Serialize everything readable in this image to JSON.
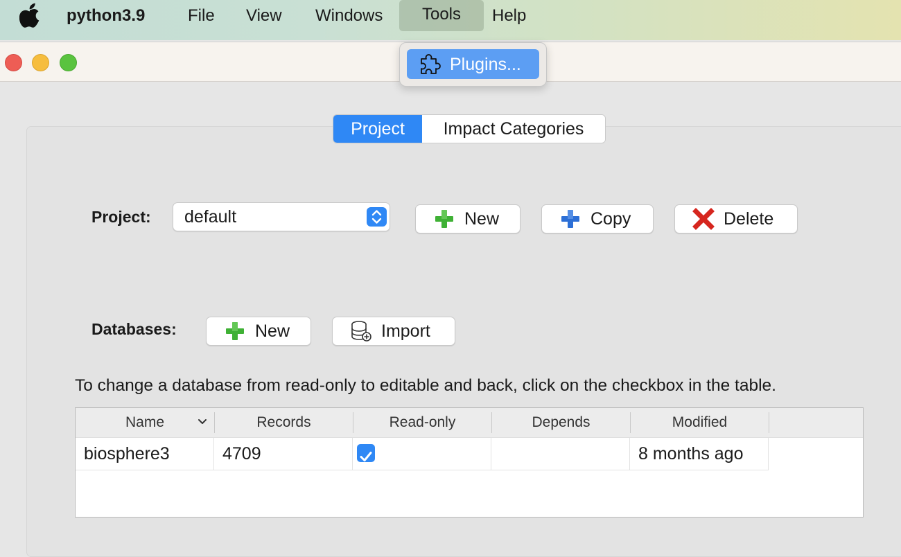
{
  "menubar": {
    "app_name": "python3.9",
    "items": [
      "File",
      "View",
      "Windows",
      "Tools",
      "Help"
    ]
  },
  "tools_menu": {
    "items": [
      {
        "label": "Plugins...",
        "icon": "puzzle-icon",
        "selected": true
      }
    ]
  },
  "tabs": [
    {
      "label": "Project",
      "active": true
    },
    {
      "label": "Impact Categories",
      "active": false
    }
  ],
  "project": {
    "label": "Project:",
    "selected": "default",
    "buttons": {
      "new": "New",
      "copy": "Copy",
      "delete": "Delete"
    }
  },
  "databases": {
    "label": "Databases:",
    "buttons": {
      "new": "New",
      "import": "Import"
    },
    "hint": "To change a database from read-only to editable and back, click on the checkbox in the table.",
    "columns": [
      "Name",
      "Records",
      "Read-only",
      "Depends",
      "Modified"
    ],
    "rows": [
      {
        "name": "biosphere3",
        "records": "4709",
        "read_only": true,
        "depends": "",
        "modified": "8 months ago"
      }
    ]
  },
  "colors": {
    "accent": "#2f88f5",
    "menu_highlight": "#5c9ef3",
    "traffic_close": "#ee5d55",
    "traffic_min": "#f6bd3e",
    "traffic_max": "#5ac33f"
  }
}
